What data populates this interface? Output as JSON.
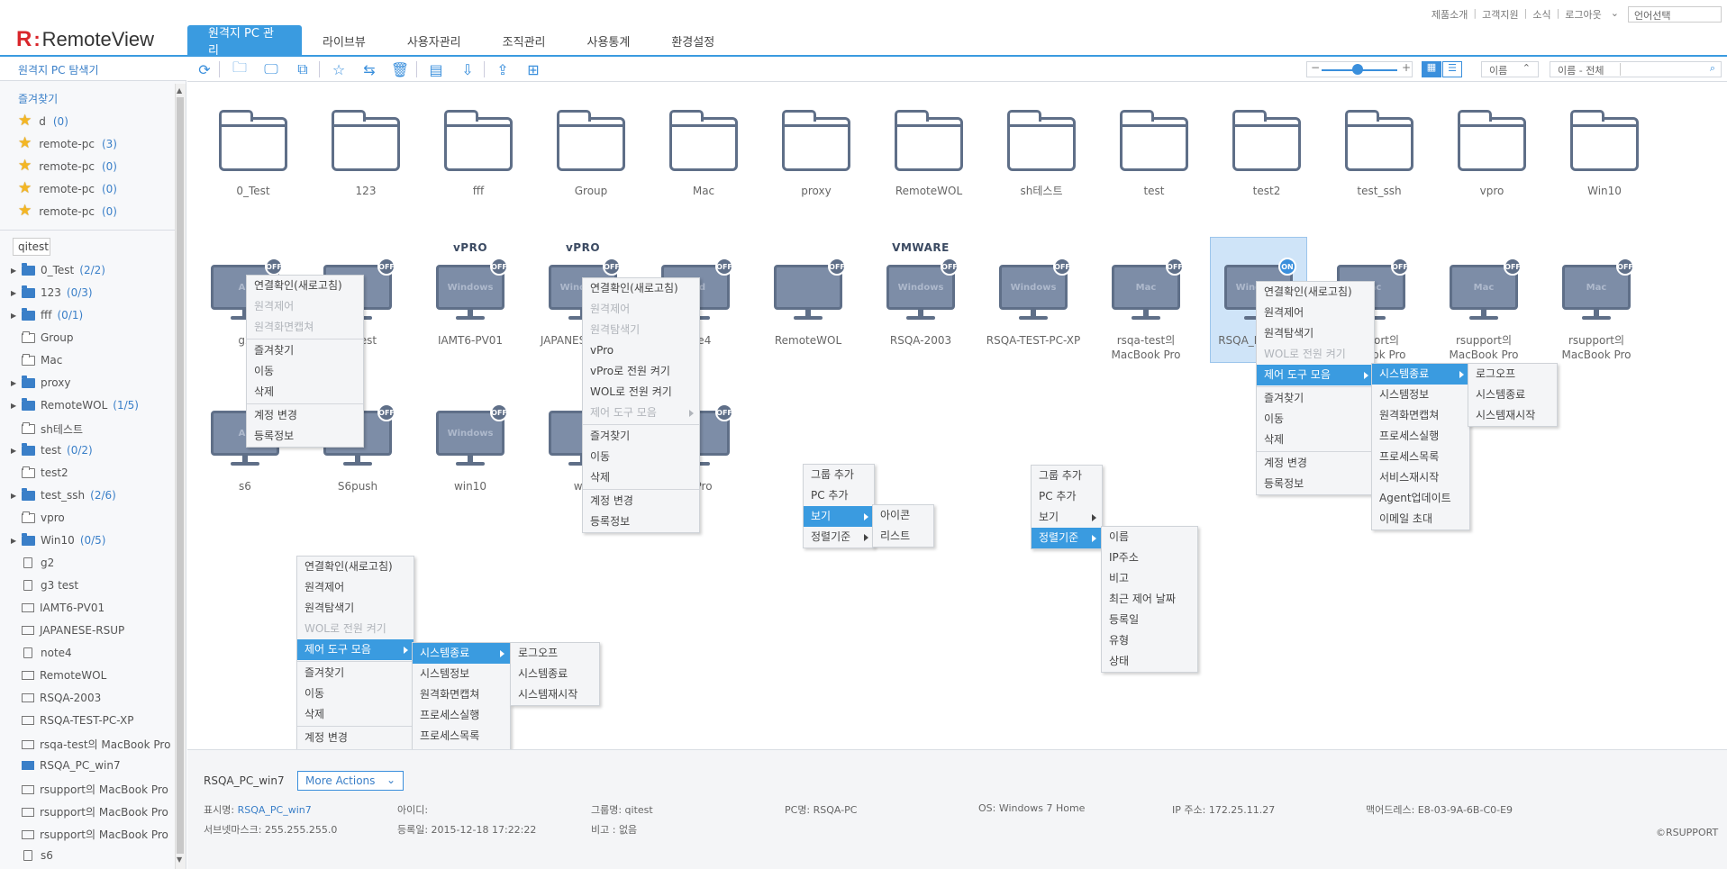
{
  "header": {
    "logo_mark": "R",
    "logo_text": "RemoteView",
    "top_links": [
      "제품소개",
      "고객지원",
      "소식",
      "로그아웃"
    ],
    "language_select": "언어선택",
    "tabs": [
      "원격지 PC 관리",
      "라이브뷰",
      "사용자관리",
      "조직관리",
      "사용통계",
      "환경설정"
    ]
  },
  "sidebar": {
    "title": "원격지 PC 탐색기",
    "favorites_title": "즐겨찾기",
    "favorites": [
      {
        "label": "d",
        "count": "(0)"
      },
      {
        "label": "remote-pc",
        "count": "(3)"
      },
      {
        "label": "remote-pc",
        "count": "(0)"
      },
      {
        "label": "remote-pc",
        "count": "(0)"
      },
      {
        "label": "remote-pc",
        "count": "(0)"
      }
    ],
    "group_root": "qitest",
    "tree": [
      {
        "label": "0_Test",
        "count": "(2/2)",
        "type": "folder-full"
      },
      {
        "label": "123",
        "count": "(0/3)",
        "type": "folder-full"
      },
      {
        "label": "fff",
        "count": "(0/1)",
        "type": "folder-full"
      },
      {
        "label": "Group",
        "count": "",
        "type": "folder-empty"
      },
      {
        "label": "Mac",
        "count": "",
        "type": "folder-empty"
      },
      {
        "label": "proxy",
        "count": "",
        "type": "folder-full"
      },
      {
        "label": "RemoteWOL",
        "count": "(1/5)",
        "type": "folder-full"
      },
      {
        "label": "sh테스트",
        "count": "",
        "type": "folder-empty"
      },
      {
        "label": "test",
        "count": "(0/2)",
        "type": "folder-full"
      },
      {
        "label": "test2",
        "count": "",
        "type": "folder-empty"
      },
      {
        "label": "test_ssh",
        "count": "(2/6)",
        "type": "folder-full"
      },
      {
        "label": "vpro",
        "count": "",
        "type": "folder-empty"
      },
      {
        "label": "Win10",
        "count": "(0/5)",
        "type": "folder-full"
      },
      {
        "label": "g2",
        "count": "",
        "type": "device"
      },
      {
        "label": "g3 test",
        "count": "",
        "type": "device"
      },
      {
        "label": "IAMT6-PV01",
        "count": "",
        "type": "monitor"
      },
      {
        "label": "JAPANESE-RSUP",
        "count": "",
        "type": "monitor"
      },
      {
        "label": "note4",
        "count": "",
        "type": "device"
      },
      {
        "label": "RemoteWOL",
        "count": "",
        "type": "monitor"
      },
      {
        "label": "RSQA-2003",
        "count": "",
        "type": "monitor"
      },
      {
        "label": "RSQA-TEST-PC-XP",
        "count": "",
        "type": "monitor"
      },
      {
        "label": "rsqa-test의 MacBook Pro",
        "count": "",
        "type": "monitor"
      },
      {
        "label": "RSQA_PC_win7",
        "count": "",
        "type": "monitor-sel"
      },
      {
        "label": "rsupport의 MacBook Pro",
        "count": "",
        "type": "monitor"
      },
      {
        "label": "rsupport의 MacBook Pro",
        "count": "",
        "type": "monitor"
      },
      {
        "label": "rsupport의 MacBook Pro",
        "count": "",
        "type": "monitor"
      },
      {
        "label": "s6",
        "count": "",
        "type": "device"
      }
    ]
  },
  "toolbar": {
    "zoom_minus": "−",
    "zoom_plus": "+",
    "zoom_level": 0.45,
    "sort_label": "이름",
    "search_label": "이름 - 전체"
  },
  "folders": [
    "0_Test",
    "123",
    "fff",
    "Group",
    "Mac",
    "proxy",
    "RemoteWOL",
    "sh테스트",
    "test",
    "test2",
    "test_ssh",
    "vpro",
    "Win10"
  ],
  "pcs_row2": [
    {
      "name": "g2",
      "tag": "",
      "screen": "An",
      "status": "OFF"
    },
    {
      "name": "g3 test",
      "tag": "",
      "screen": "",
      "status": "OFF"
    },
    {
      "name": "IAMT6-PV01",
      "tag": "vPRO",
      "screen": "Windows",
      "status": "OFF"
    },
    {
      "name": "JAPANESE-RSUP",
      "tag": "vPRO",
      "screen": "Windows",
      "status": "OFF"
    },
    {
      "name": "note4",
      "tag": "",
      "screen": "And",
      "status": "OFF"
    },
    {
      "name": "RemoteWOL",
      "tag": "",
      "screen": "",
      "status": "OFF"
    },
    {
      "name": "RSQA-2003",
      "tag": "VMWARE",
      "screen": "Windows",
      "status": "OFF"
    },
    {
      "name": "RSQA-TEST-PC-XP",
      "tag": "",
      "screen": "Windows",
      "status": "OFF"
    },
    {
      "name": "rsqa-test의 MacBook Pro",
      "tag": "",
      "screen": "Mac",
      "status": "OFF"
    },
    {
      "name": "RSQA_PC_win7",
      "tag": "",
      "screen": "Windows",
      "status": "ON"
    },
    {
      "name": "rsupport의 MacBook Pro",
      "tag": "",
      "screen": "Mac",
      "status": "OFF"
    },
    {
      "name": "rsupport의 MacBook Pro",
      "tag": "",
      "screen": "Mac",
      "status": "OFF"
    },
    {
      "name": "rsupport의 MacBook Pro",
      "tag": "",
      "screen": "Mac",
      "status": "OFF"
    }
  ],
  "pcs_row3": [
    {
      "name": "s6",
      "screen": "An",
      "status": "OFF"
    },
    {
      "name": "S6push",
      "screen": "",
      "status": "OFF"
    },
    {
      "name": "win10",
      "screen": "Windows",
      "status": "OFF"
    },
    {
      "name": "wol",
      "screen": "",
      "status": "OFF"
    },
    {
      "name": "ok Pro",
      "screen": "",
      "status": "OFF"
    }
  ],
  "menus": {
    "menu_a": [
      "연결확인(새로고침)",
      "원격제어",
      "원격화면캡쳐",
      "즐겨찾기",
      "이동",
      "삭제",
      "계정 변경",
      "등록정보"
    ],
    "menu_b": [
      "연결확인(새로고침)",
      "원격제어",
      "원격탐색기",
      "vPro",
      "vPro로 전원 켜기",
      "WOL로 전원 켜기",
      "제어 도구 모음",
      "즐겨찾기",
      "이동",
      "삭제",
      "계정 변경",
      "등록정보"
    ],
    "menu_c": [
      "연결확인(새로고침)",
      "원격제어",
      "원격탐색기",
      "WOL로 전원 켜기",
      "제어 도구 모음",
      "즐겨찾기",
      "이동",
      "삭제",
      "계정 변경",
      "등록정보"
    ],
    "tools_sub": [
      "시스템종료",
      "시스템정보",
      "원격화면캡쳐",
      "프로세스실행",
      "프로세스목록",
      "서비스재시작",
      "Agent업데이트",
      "이메일 초대"
    ],
    "shutdown_sub": [
      "로그오프",
      "시스템종료",
      "시스템재시작"
    ],
    "bg_menu": [
      "그룹 추가",
      "PC 추가",
      "보기",
      "정렬기준"
    ],
    "view_sub": [
      "아이콘",
      "리스트"
    ],
    "sort_sub": [
      "이름",
      "IP주소",
      "비고",
      "최근 제어 날짜",
      "등록일",
      "유형",
      "상태"
    ]
  },
  "bottom": {
    "selected_name": "RSQA_PC_win7",
    "more_actions": "More Actions",
    "display_name_label": "표시명:",
    "display_name": "RSQA_PC_win7",
    "subnet": "서브넷마스크: 255.255.255.0",
    "id_label": "아이디: ",
    "reg_date": "등록일: 2015-12-18 17:22:22",
    "group": "그룹명: qitest",
    "note": "비고 : 없음",
    "pc_name": "PC명: RSQA-PC",
    "os": "OS: Windows 7 Home",
    "ip": "IP 주소: 172.25.11.27",
    "mac": "맥어드레스: E8-03-9A-6B-C0-E9",
    "copyright": "©RSUPPORT"
  },
  "colors": {
    "accent": "#3a9be0",
    "icon": "#5f6f88",
    "screen": "#7d8da7",
    "logo": "#d9262b"
  }
}
